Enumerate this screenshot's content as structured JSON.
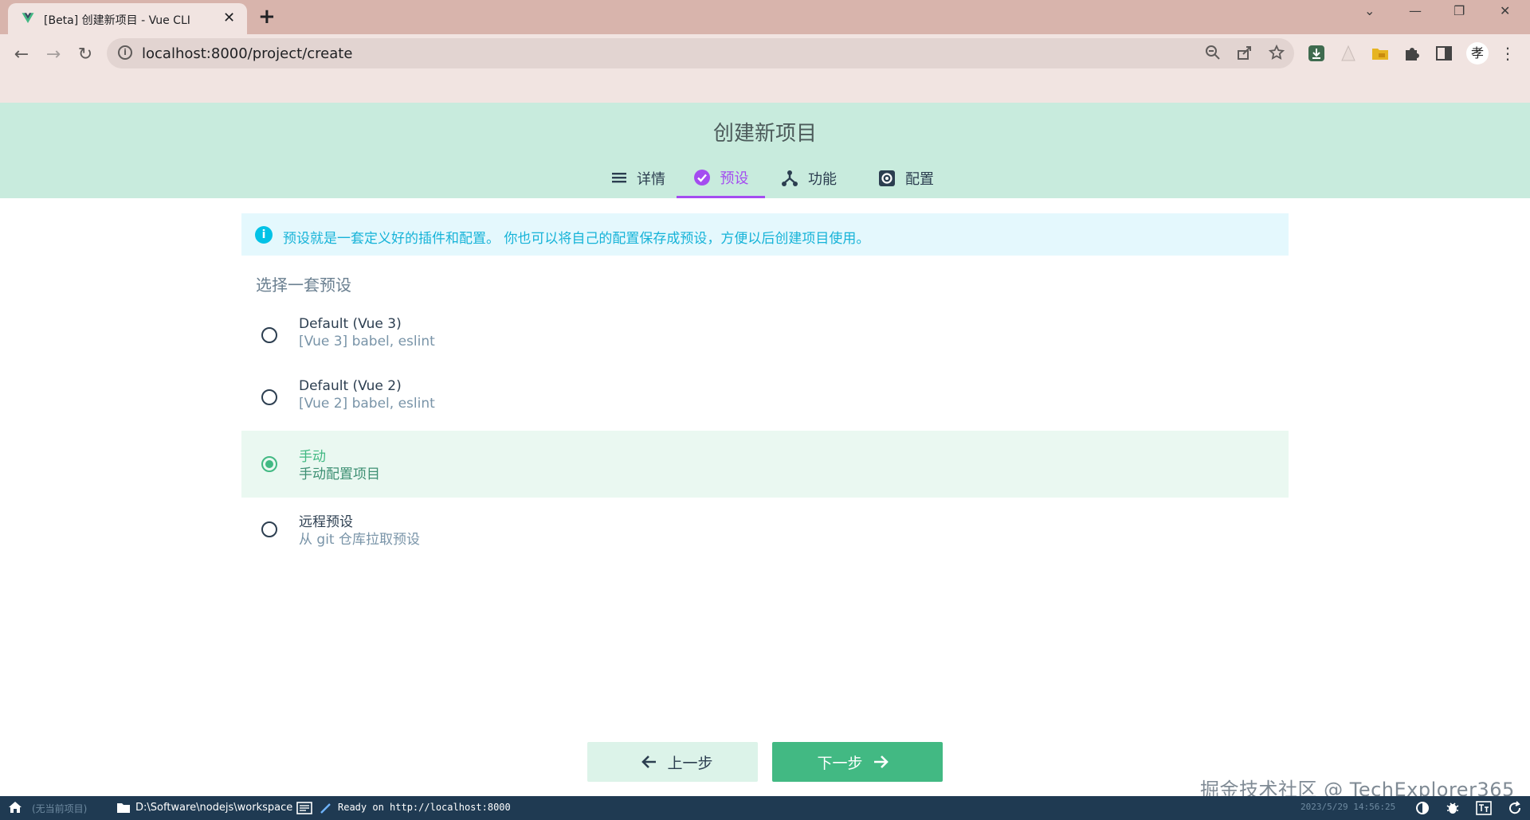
{
  "browser": {
    "tab_title": "[Beta] 创建新项目 - Vue CLI",
    "close_glyph": "✕",
    "newtab_glyph": "+",
    "url": "localhost:8000/project/create",
    "window_controls": {
      "dropdown": "⌄",
      "minimize": "—",
      "restore": "❐",
      "close": "✕"
    },
    "nav": {
      "back": "←",
      "forward": "→",
      "reload": "↻"
    },
    "ext_letter": "孝"
  },
  "header": {
    "title": "创建新项目",
    "steps": [
      {
        "label": "详情",
        "icon": "list-icon",
        "active": false
      },
      {
        "label": "预设",
        "icon": "check-circle-icon",
        "active": true
      },
      {
        "label": "功能",
        "icon": "fork-icon",
        "active": false
      },
      {
        "label": "配置",
        "icon": "settings-icon",
        "active": false
      }
    ]
  },
  "info": {
    "text": "预设就是一套定义好的插件和配置。 你也可以将自己的配置保存成预设，方便以后创建项目使用。"
  },
  "presets": {
    "label": "选择一套预设",
    "items": [
      {
        "name": "Default (Vue 3)",
        "desc": "[Vue 3] babel, eslint",
        "selected": false
      },
      {
        "name": "Default (Vue 2)",
        "desc": "[Vue 2] babel, eslint",
        "selected": false
      },
      {
        "name": "手动",
        "desc": "手动配置项目",
        "selected": true
      },
      {
        "name": "远程预设",
        "desc": "从 git 仓库拉取预设",
        "selected": false
      }
    ]
  },
  "buttons": {
    "prev": "上一步",
    "next": "下一步"
  },
  "watermark": "掘金技术社区 @ TechExplorer365",
  "statusbar": {
    "project": "(无当前项目)",
    "path": "D:\\Software\\nodejs\\workspace",
    "log": "Ready on http://localhost:8000",
    "time": "2023/5/29 14:56:25"
  },
  "colors": {
    "accent": "#42b983",
    "header_bg": "#c8ebdd",
    "step_active": "#a44cf0",
    "info": "#03c2e6",
    "statusbar_bg": "#1f3a52"
  }
}
